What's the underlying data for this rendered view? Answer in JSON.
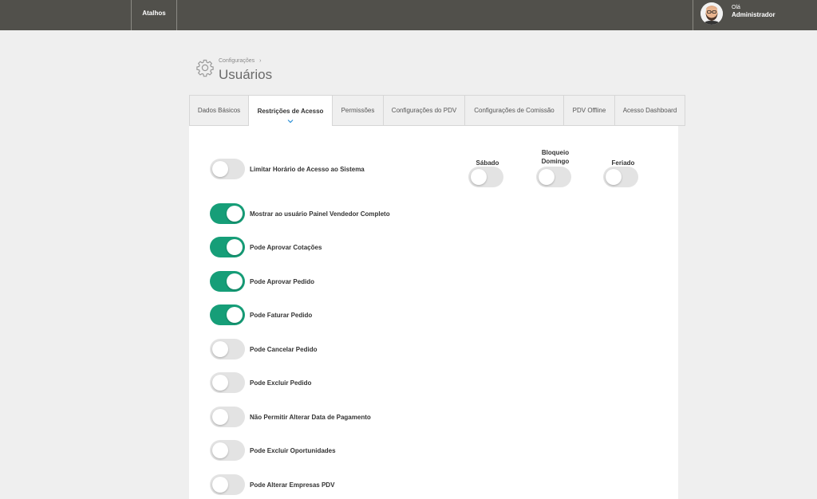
{
  "topbar": {
    "shortcuts_label": "Atalhos",
    "greeting": "Olá",
    "user_name": "Administrador"
  },
  "breadcrumb": {
    "parent": "Configurações",
    "separator": "›"
  },
  "page_title": "Usuários",
  "tabs": [
    {
      "label": "Dados Básicos",
      "active": false
    },
    {
      "label": "Restrições de Acesso",
      "active": true
    },
    {
      "label": "Permissões",
      "active": false
    },
    {
      "label": "Configurações do PDV",
      "active": false
    },
    {
      "label": "Configurações de Comissão",
      "active": false
    },
    {
      "label": "PDV Offline",
      "active": false
    },
    {
      "label": "Acesso Dashboard",
      "active": false
    }
  ],
  "restrictions": [
    {
      "label": "Limitar Horário de Acesso ao Sistema",
      "on": false
    },
    {
      "label": "Mostrar ao usuário Painel Vendedor Completo",
      "on": true
    },
    {
      "label": "Pode Aprovar Cotações",
      "on": true
    },
    {
      "label": "Pode Aprovar Pedido",
      "on": true
    },
    {
      "label": "Pode Faturar Pedido",
      "on": true
    },
    {
      "label": "Pode Cancelar Pedido",
      "on": false
    },
    {
      "label": "Pode Excluir Pedido",
      "on": false
    },
    {
      "label": "Não Permitir Alterar Data de Pagamento",
      "on": false
    },
    {
      "label": "Pode Excluir Oportunidades",
      "on": false
    },
    {
      "label": "Pode Alterar Empresas PDV",
      "on": false
    }
  ],
  "day_options": [
    {
      "label_line1": "Sábado",
      "label_line2": "",
      "on": false
    },
    {
      "label_line1": "Bloqueio",
      "label_line2": "Domingo",
      "on": false
    },
    {
      "label_line1": "Feriado",
      "label_line2": "",
      "on": false
    }
  ],
  "colors": {
    "topbar": "#51504b",
    "toggle_on": "#169e78",
    "toggle_off": "#e3e3e3",
    "accent_chevron": "#2b8fd6"
  }
}
